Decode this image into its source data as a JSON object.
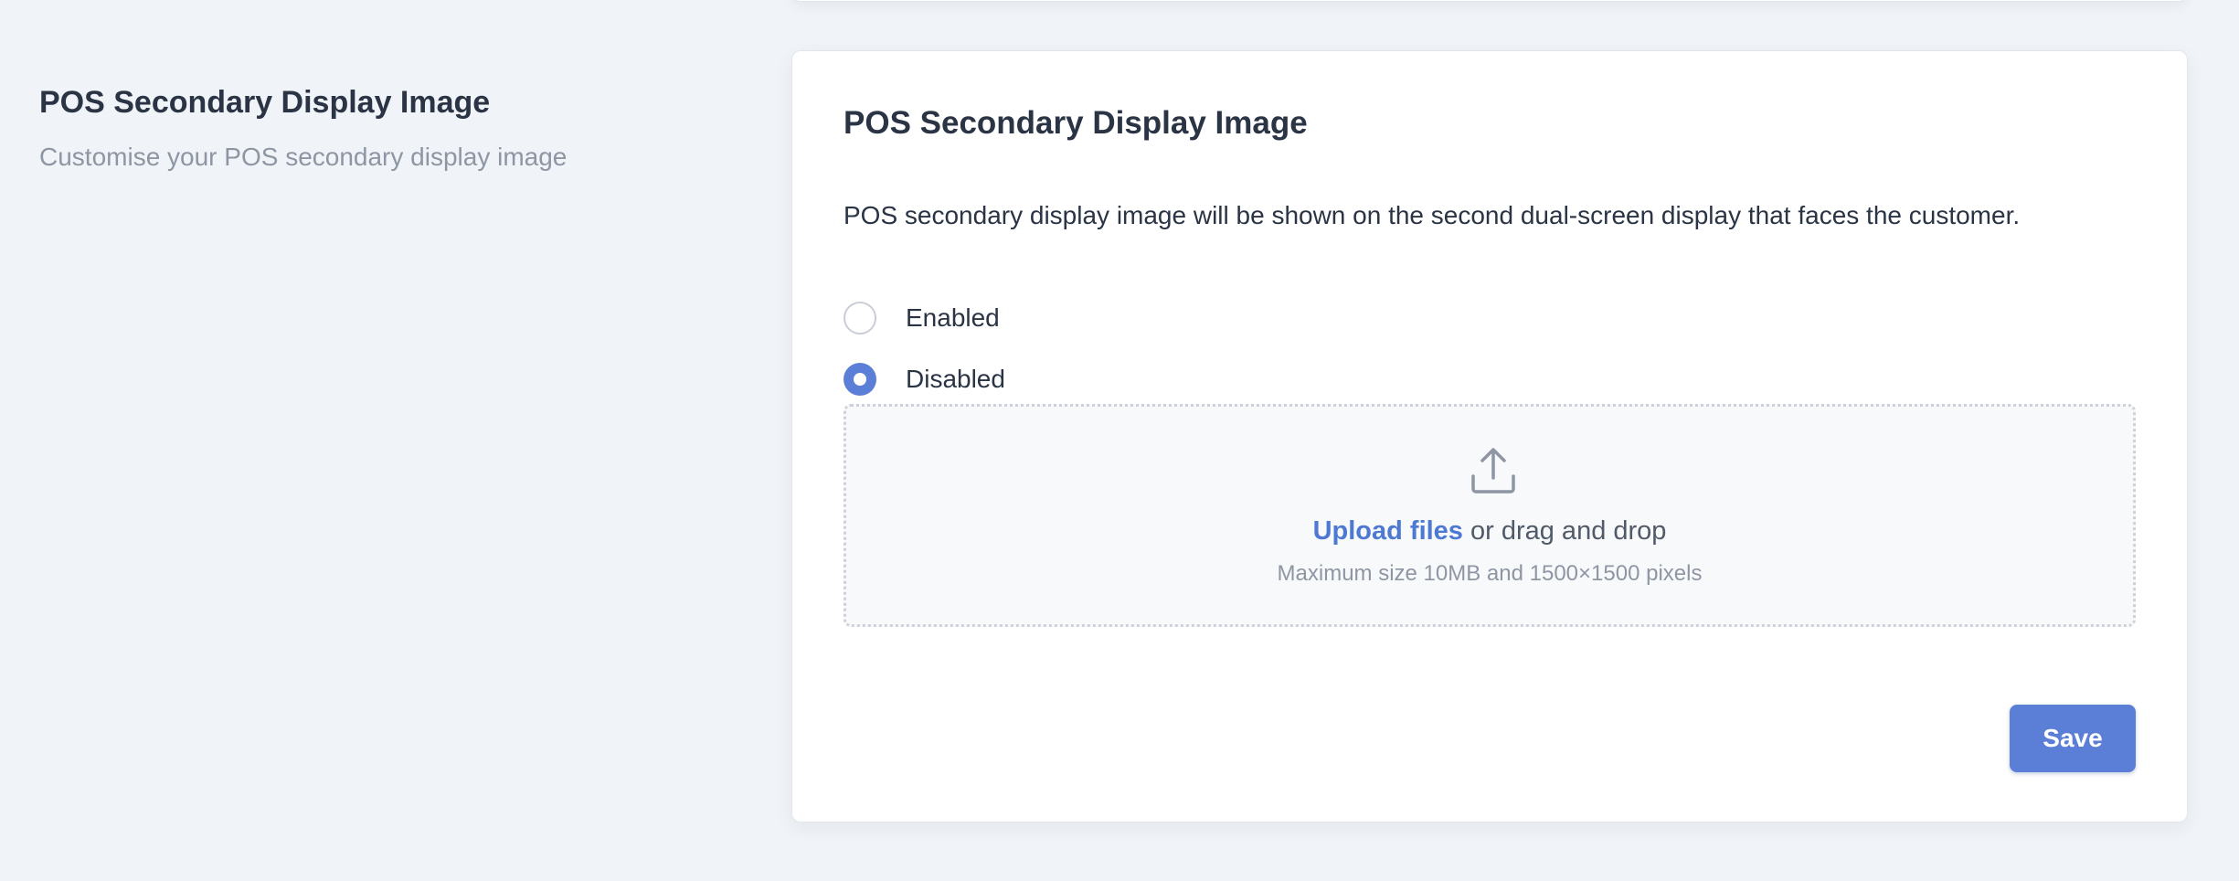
{
  "section": {
    "title": "POS Secondary Display Image",
    "subtitle": "Customise your POS secondary display image"
  },
  "card": {
    "title": "POS Secondary Display Image",
    "description": "POS secondary display image will be shown on the second dual-screen display that faces the customer."
  },
  "radio": {
    "options": [
      {
        "label": "Enabled",
        "checked": false
      },
      {
        "label": "Disabled",
        "checked": true
      }
    ]
  },
  "upload": {
    "icon": "upload-icon",
    "link_label": "Upload files",
    "rest_label": " or drag and drop",
    "hint": "Maximum size 10MB and 1500×1500 pixels"
  },
  "actions": {
    "save_label": "Save"
  },
  "colors": {
    "accent": "#5b7fd6",
    "link": "#4e79d3",
    "background": "#f0f3f7"
  }
}
